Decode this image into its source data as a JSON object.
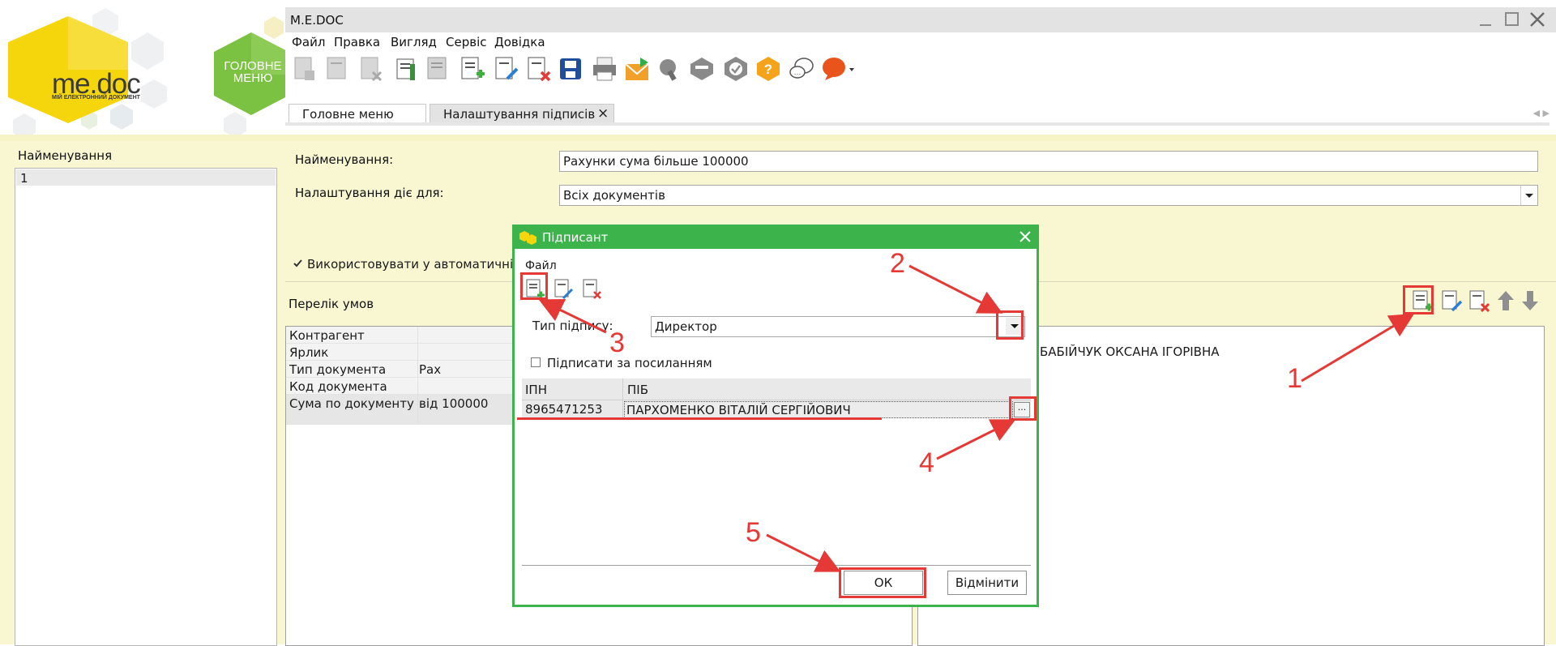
{
  "brand": {
    "logo_text": "me.doc",
    "logo_subtitle": "МІЙ ЕЛЕКТРОННИЙ ДОКУМЕНТ",
    "home_button": "ГОЛОВНЕ МЕНЮ",
    "colors": {
      "yellow": "#f5d60c",
      "green": "#7cc242",
      "accent_green": "#3cb44b",
      "annotation_red": "#e53935"
    }
  },
  "window": {
    "title": "M.E.DOC"
  },
  "menu": [
    "Файл",
    "Правка",
    "Вигляд",
    "Сервіс",
    "Довідка"
  ],
  "tabs": [
    {
      "label": "Головне меню",
      "active": false
    },
    {
      "label": "Налаштування підписів",
      "active": true,
      "close": "×"
    }
  ],
  "left_panel": {
    "header": "Найменування",
    "rows": [
      "1"
    ]
  },
  "form": {
    "name_label": "Найменування:",
    "name_value": "Рахунки сума більше 100000",
    "applies_label": "Налаштування діє для:",
    "applies_value": "Всіх документів",
    "auto_checkbox_label": "Використовувати у автоматичній"
  },
  "conditions": {
    "title": "Перелік умов",
    "rows": [
      {
        "name": "Контрагент",
        "value": ""
      },
      {
        "name": "Ярлик",
        "value": ""
      },
      {
        "name": "Тип документа",
        "value": "Рах"
      },
      {
        "name": "Код документа",
        "value": ""
      },
      {
        "name": "Сума по документу",
        "value": "від 100000"
      }
    ]
  },
  "signers_list": {
    "names": [
      "БАБІЙЧУК ОКСАНА ІГОРІВНА"
    ]
  },
  "dialog": {
    "title": "Підписант",
    "file_menu": "Файл",
    "sign_type_label": "Тип підпису:",
    "sign_type_value": "Директор",
    "by_reference_label": "Підписати за посиланням",
    "columns": [
      "ІПН",
      "ПІБ"
    ],
    "row": {
      "ipn": "8965471253",
      "pib": "ПАРХОМЕНКО ВІТАЛІЙ СЕРГІЙОВИЧ"
    },
    "ellipsis": "...",
    "ok": "ОК",
    "cancel": "Відмінити"
  },
  "annotations": [
    "1",
    "2",
    "3",
    "4",
    "5"
  ]
}
